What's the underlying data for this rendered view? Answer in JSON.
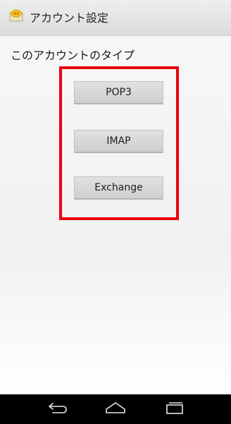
{
  "app": {
    "title": "アカウント設定",
    "icon": "email-app-icon",
    "icon_color": "#f0c419"
  },
  "section": {
    "label": "このアカウントのタイプ"
  },
  "account_types": [
    {
      "label": "POP3"
    },
    {
      "label": "IMAP"
    },
    {
      "label": "Exchange"
    }
  ],
  "nav_bar": {
    "back_icon": "back-icon",
    "home_icon": "home-icon",
    "recent_icon": "recent-apps-icon"
  },
  "colors": {
    "highlight": "#e8000b",
    "nav_bar": "#000000"
  }
}
